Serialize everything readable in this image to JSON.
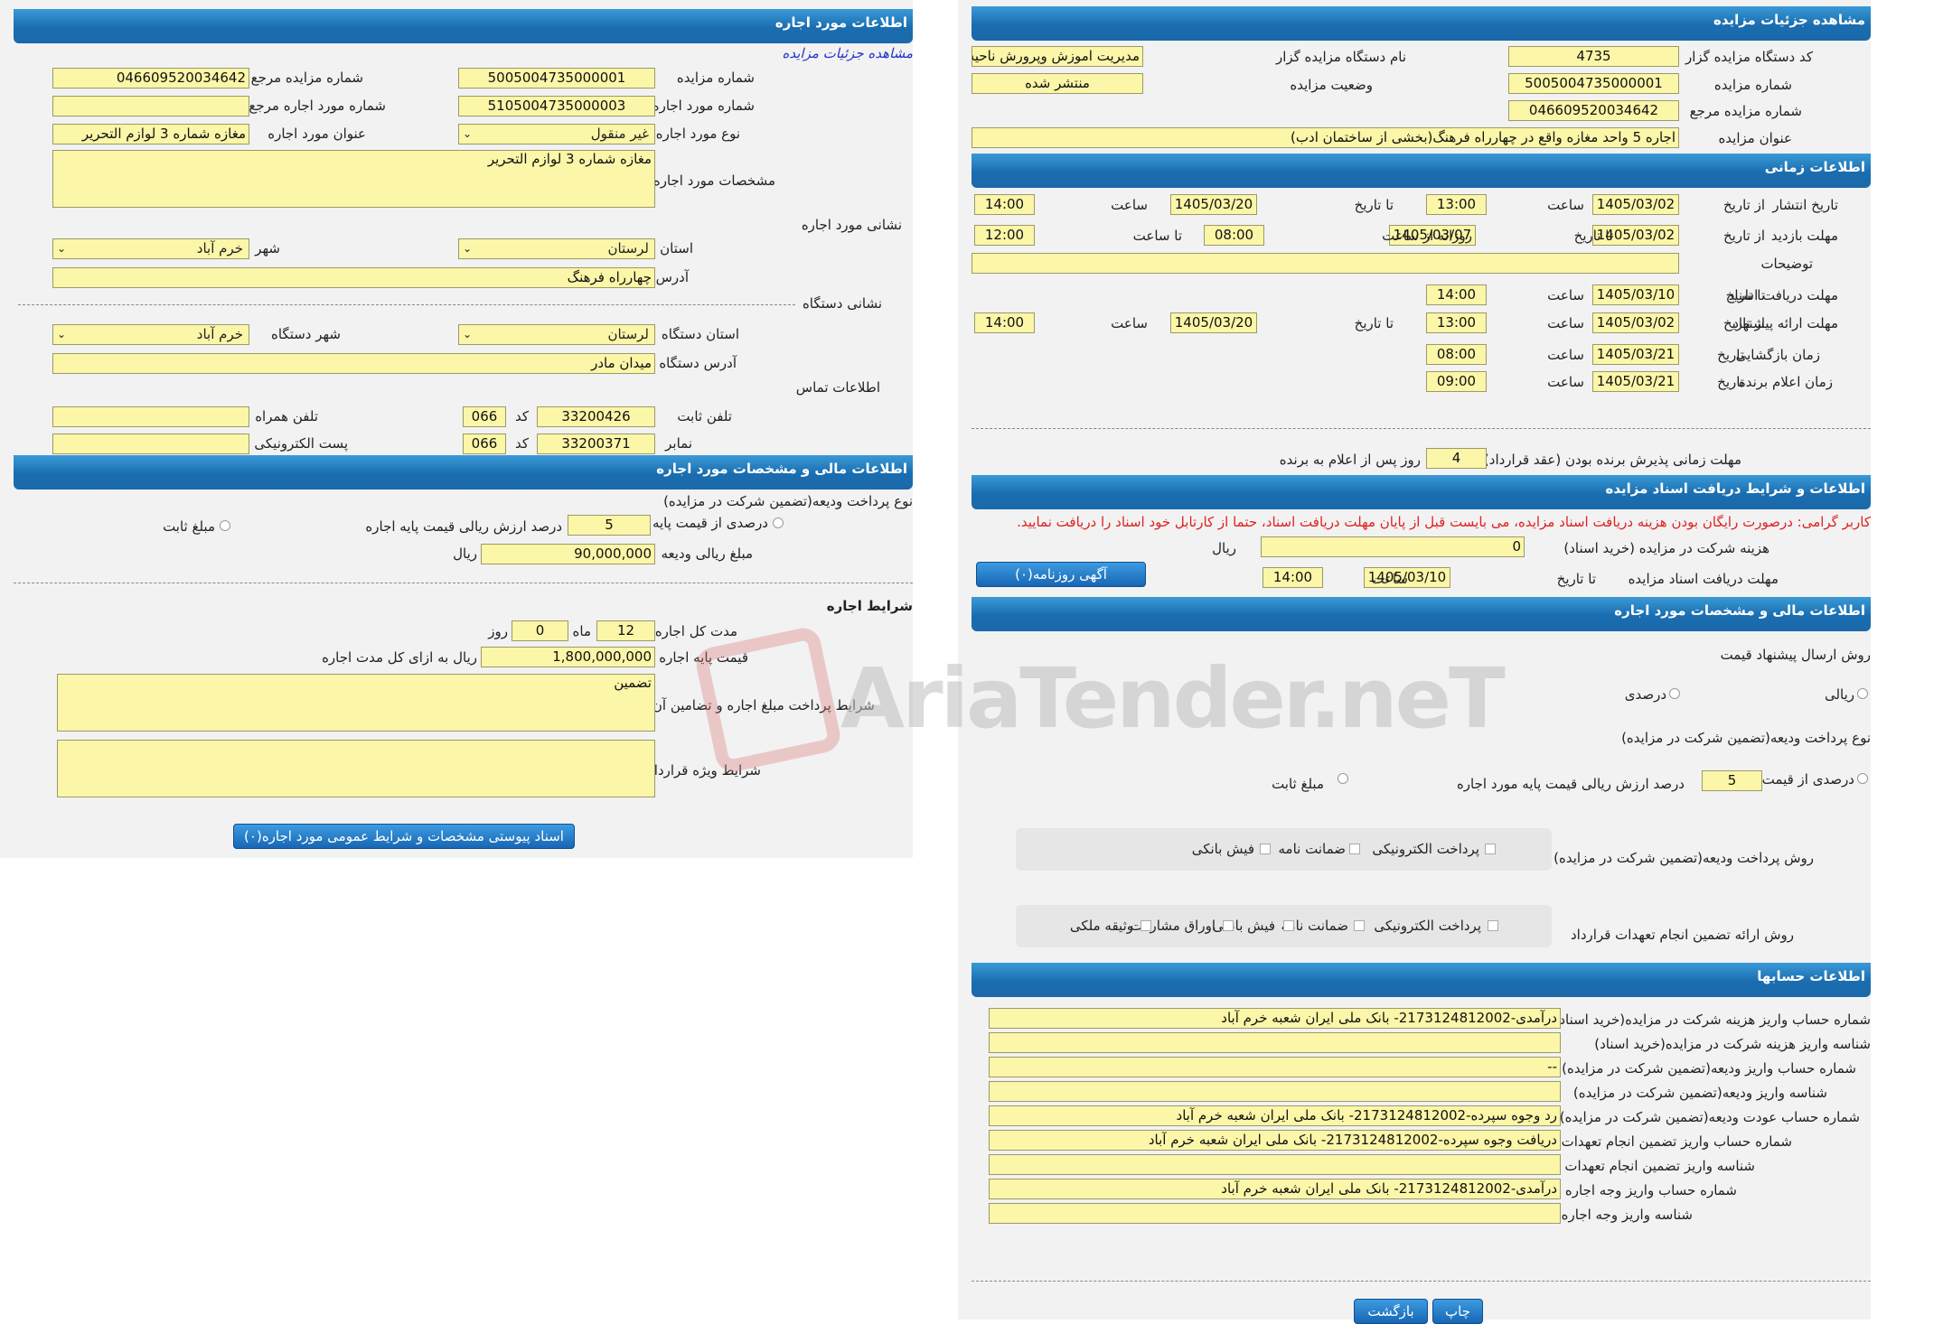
{
  "left": {
    "header": "اطلاعات مورد اجاره",
    "view_link": "مشاهده جزئیات مزایده",
    "auction_no_label": "شماره مزایده",
    "auction_no": "5005004735000001",
    "ref_auction_no_label": "شماره مزایده مرجع",
    "ref_auction_no": "046609520034642",
    "lease_no_label": "شماره مورد اجاره",
    "lease_no": "5105004735000003",
    "ref_lease_no_label": "شماره مورد اجاره مرجع",
    "ref_lease_no": "",
    "lease_type_label": "نوع مورد اجاره",
    "lease_type": "غیر منقول",
    "lease_title_label": "عنوان مورد اجاره",
    "lease_title": "مغازه شماره 3 لوازم التحریر",
    "lease_spec_label": "مشخصات مورد اجاره",
    "lease_spec": "مغازه شماره 3 لوازم التحریر",
    "lease_address_label": "نشانی مورد اجاره",
    "province_label": "استان",
    "province": "لرستان",
    "city_label": "شهر",
    "city": "خرم آباد",
    "address_label": "آدرس",
    "address": "چهارراه فرهنگ",
    "org_address_label": "نشانی دستگاه",
    "org_province_label": "استان دستگاه",
    "org_province": "لرستان",
    "org_city_label": "شهر دستگاه",
    "org_city": "خرم آباد",
    "org_addr_label": "آدرس دستگاه",
    "org_addr": "میدان مادر",
    "contact_label": "اطلاعات تماس",
    "phone_label": "تلفن ثابت",
    "phone": "33200426",
    "code_label": "کد",
    "phone_code": "066",
    "mobile_label": "تلفن همراه",
    "mobile": "",
    "fax_label": "نمابر",
    "fax": "33200371",
    "fax_code": "066",
    "email_label": "پست الکترونیکی",
    "email": "",
    "fin_header": "اطلاعات مالی و مشخصات مورد اجاره",
    "deposit_type_label": "نوع پرداخت ودیعه(تضمین شرکت در مزایده)",
    "percent_label": "درصدی از قیمت پایه",
    "percent_value": "5",
    "percent_suffix": "درصد ارزش ریالی قیمت پایه اجاره",
    "fixed_label": "مبلغ ثابت",
    "deposit_amount_label": "مبلغ ریالی ودیعه",
    "deposit_amount": "90,000,000",
    "rial": "ریال",
    "terms_header": "شرایط اجاره",
    "duration_label": "مدت کل اجاره",
    "duration_months": "12",
    "month_label": "ماه",
    "duration_days": "0",
    "day_label": "روز",
    "base_price_label": "قیمت پایه اجاره",
    "base_price": "1,800,000,000",
    "base_price_suffix": "ریال به ازای کل مدت اجاره",
    "payment_terms_label": "شرایط پرداخت مبلغ اجاره و تضامین آن",
    "payment_terms": "تضمین",
    "special_terms_label": "شرایط ویژه قرارداد",
    "special_terms": "",
    "attach_button": "اسناد پیوستی مشخصات و شرایط عمومی مورد اجاره(۰)"
  },
  "right": {
    "header": "مشاهده جزئیات مزایده",
    "org_code_label": "کد دستگاه مزایده گزار",
    "org_code": "4735",
    "org_name_label": "نام دستگاه مزایده گزار",
    "org_name": "مدیریت اموزش وپرورش ناحیه",
    "auction_no_label": "شماره مزایده",
    "auction_no": "5005004735000001",
    "status_label": "وضعیت مزایده",
    "status": "منتشر شده",
    "ref_no_label": "شماره مزایده مرجع",
    "ref_no": "046609520034642",
    "title_label": "عنوان مزایده",
    "title": "اجاره 5 واحد مغازه واقع در چهارراه فرهنگ(بخشی از ساختمان ادب)",
    "time_header": "اطلاعات زمانی",
    "publish_label": "تاریخ انتشار",
    "from_date": "از تاریخ",
    "to_date": "تا تاریخ",
    "time_label": "ساعت",
    "publish_from": "1405/03/02",
    "publish_time": "13:00",
    "publish_to": "1405/03/20",
    "publish_to_time": "14:00",
    "visit_label": "مهلت بازدید",
    "visit_from": "1405/03/02",
    "visit_to": "1405/03/07",
    "daily_from_label": "روزانه از ساعت",
    "visit_daily_from": "08:00",
    "to_time_label": "تا ساعت",
    "visit_daily_to": "12:00",
    "notes_label": "توضیحات",
    "notes": "",
    "doc_deadline_label": "مهلت دریافت اسناد",
    "doc_to": "1405/03/10",
    "doc_time": "14:00",
    "offer_label": "مهلت ارائه پیشنهاد",
    "offer_from": "1405/03/02",
    "offer_time": "13:00",
    "offer_to": "1405/03/20",
    "offer_to_time": "14:00",
    "opening_label": "زمان بازگشایی",
    "date_label": "تاریخ",
    "opening_date": "1405/03/21",
    "opening_time": "08:00",
    "winner_label": "زمان اعلام برنده",
    "winner_date": "1405/03/21",
    "winner_time": "09:00",
    "accept_label": "مهلت زمانی پذیرش برنده بودن (عقد قرارداد)",
    "accept_days": "4",
    "accept_suffix": "روز پس از اعلام به برنده",
    "doc_header": "اطلاعات و شرایط دریافت اسناد مزایده",
    "warning": "کاربر گرامی: درصورت رایگان بودن هزینه دریافت اسناد مزایده، می بایست قبل از پایان مهلت دریافت اسناد، حتما از کارتابل خود اسناد را دریافت نمایید.",
    "fee_label": "هزینه شرکت در مزایده (خرید اسناد)",
    "fee": "0",
    "rial": "ریال",
    "doc_deadline2_label": "مهلت دریافت اسناد مزایده",
    "doc_to2": "1405/03/10",
    "doc_time2": "14:00",
    "newspaper_button": "آگهی روزنامه(۰)",
    "fin_header": "اطلاعات مالی و مشخصات مورد اجاره",
    "price_method_label": "روش ارسال پیشنهاد قیمت",
    "rial_option": "ریالی",
    "percent_option": "درصدی",
    "deposit_type_label": "نوع پرداخت ودیعه(تضمین شرکت در مزایده)",
    "percent_base_label": "درصدی از قیمت پایه",
    "percent_value": "5",
    "percent_suffix": "درصد ارزش ریالی قیمت پایه مورد اجاره",
    "fixed_label": "مبلغ ثابت",
    "deposit_method_label": "روش پرداخت ودیعه(تضمین شرکت در مزایده)",
    "opt_electronic": "پرداخت الکترونیکی",
    "opt_guarantee": "ضمانت نامه",
    "opt_receipt": "فیش بانکی",
    "guarantee_method_label": "روش ارائه تضمین انجام تعهدات قرارداد",
    "opt_bonds": "اوراق مشارکت",
    "opt_property": "وثیقه ملکی",
    "accounts_header": "اطلاعات حسابها",
    "acc1_label": "شماره حساب واریز هزینه شرکت در مزایده(خرید اسناد)",
    "acc1": "درآمدی-2173124812002- بانک ملی ایران شعبه خرم آباد",
    "acc2_label": "شناسه واریز هزینه شرکت در مزایده(خرید اسناد)",
    "acc2": "",
    "acc3_label": "شماره حساب واریز ودیعه(تضمین شرکت در مزایده)",
    "acc3": "--",
    "acc4_label": "شناسه واریز ودیعه(تضمین شرکت در مزایده)",
    "acc4": "",
    "acc5_label": "شماره حساب عودت ودیعه(تضمین شرکت در مزایده)",
    "acc5": "رد وجوه سپرده-2173124812002- بانک ملی ایران شعبه خرم آباد",
    "acc6_label": "شماره حساب واریز تضمین انجام تعهدات",
    "acc6": "دریافت وجوه سپرده-2173124812002- بانک ملی ایران شعبه خرم آباد",
    "acc7_label": "شناسه واریز تضمین انجام تعهدات",
    "acc7": "",
    "acc8_label": "شماره حساب واریز وجه اجاره",
    "acc8": "درآمدی-2173124812002- بانک ملی ایران شعبه خرم آباد",
    "acc9_label": "شناسه واریز وجه اجاره",
    "acc9": "",
    "print_button": "چاپ",
    "back_button": "بازگشت"
  },
  "watermark": "AriaTender.neT",
  "colors": {
    "header": "#1a6db0",
    "field": "#fbf6a8",
    "panel": "#f2f2f2",
    "warning": "#e02020"
  }
}
